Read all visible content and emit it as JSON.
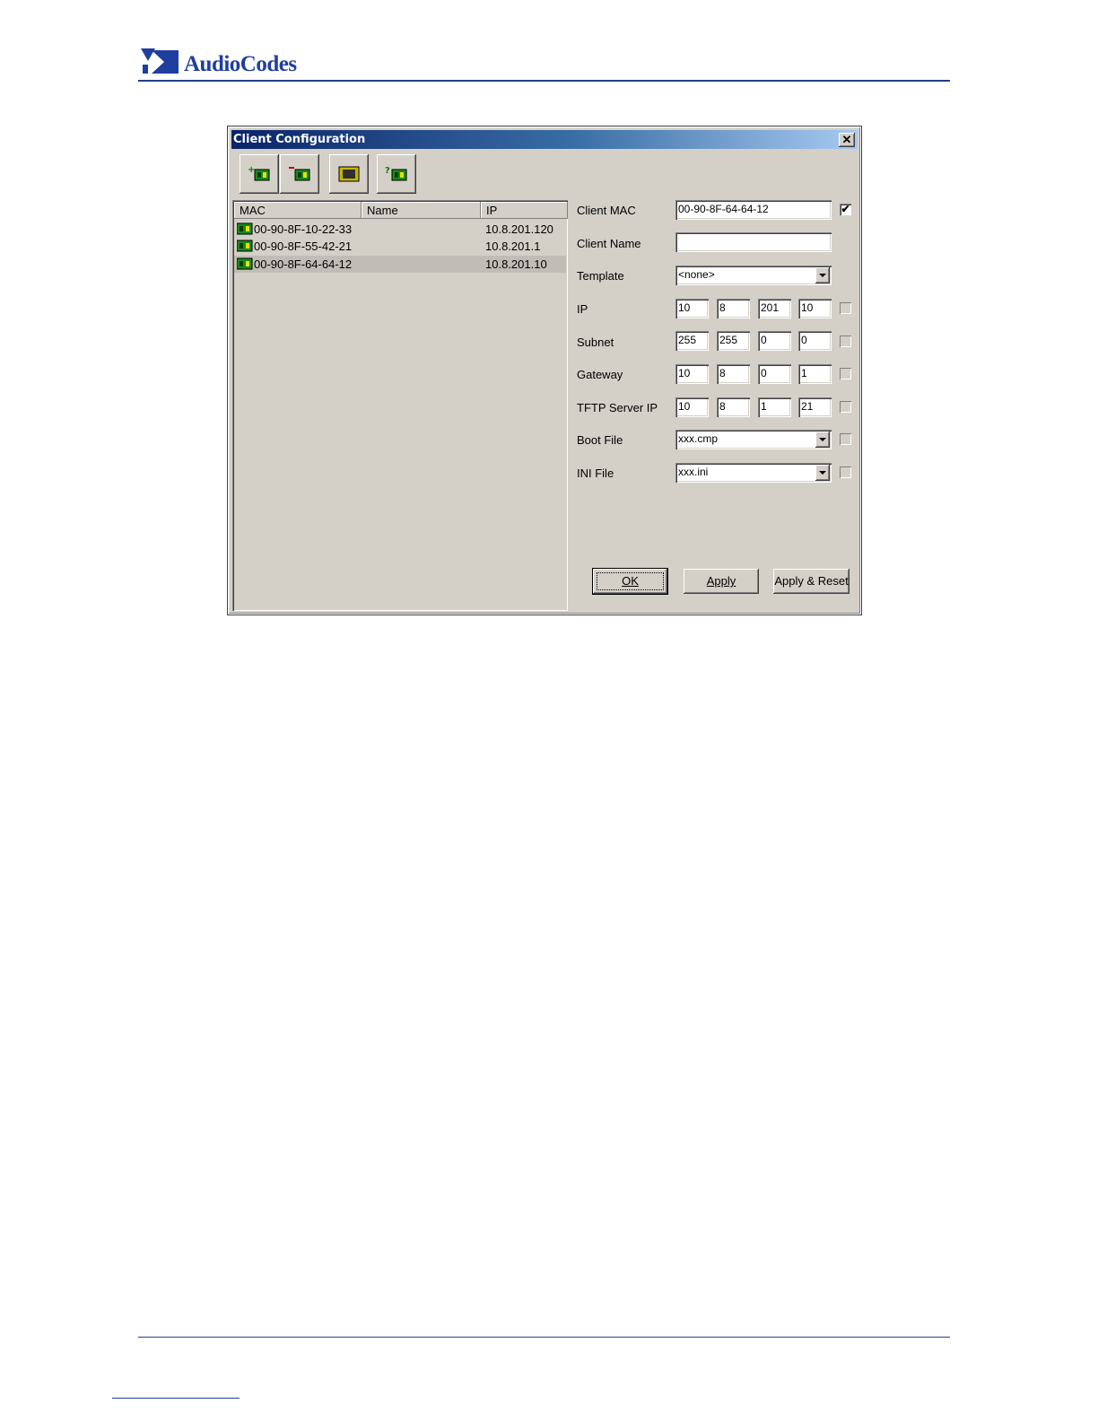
{
  "page": {
    "logo_text": "AudioCodes"
  },
  "dialog": {
    "title": "Client Configuration",
    "close_glyph": "✕",
    "toolbar": [
      {
        "icon": "add-client-icon"
      },
      {
        "icon": "remove-client-icon"
      },
      {
        "icon": "templates-icon"
      },
      {
        "icon": "client-info-icon"
      }
    ],
    "list": {
      "columns": [
        "MAC",
        "Name",
        "IP"
      ],
      "rows": [
        {
          "mac": "00-90-8F-10-22-33",
          "name": "",
          "ip": "10.8.201.120",
          "selected": false
        },
        {
          "mac": "00-90-8F-55-42-21",
          "name": "",
          "ip": "10.8.201.1",
          "selected": false
        },
        {
          "mac": "00-90-8F-64-64-12",
          "name": "",
          "ip": "10.8.201.10",
          "selected": true
        }
      ]
    },
    "form": {
      "client_mac_label": "Client MAC",
      "client_mac_value": "00-90-8F-64-64-12",
      "client_mac_checked": true,
      "client_name_label": "Client Name",
      "client_name_value": "",
      "template_label": "Template",
      "template_value": "<none>",
      "ip_label": "IP",
      "ip": [
        "10",
        "8",
        "201",
        "10"
      ],
      "subnet_label": "Subnet",
      "subnet": [
        "255",
        "255",
        "0",
        "0"
      ],
      "gateway_label": "Gateway",
      "gateway": [
        "10",
        "8",
        "0",
        "1"
      ],
      "tftp_label": "TFTP Server IP",
      "tftp": [
        "10",
        "8",
        "1",
        "21"
      ],
      "boot_file_label": "Boot File",
      "boot_file_value": "xxx.cmp",
      "ini_file_label": "INI File",
      "ini_file_value": "xxx.ini",
      "check_glyph": "✔"
    },
    "buttons": {
      "ok": "OK",
      "apply": "Apply",
      "apply_reset": "Apply & Reset"
    }
  }
}
